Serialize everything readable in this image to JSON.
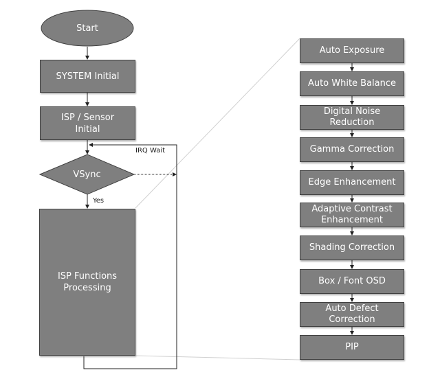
{
  "main_flow": {
    "start": "Start",
    "system_initial": "SYSTEM Initial",
    "sensor_initial": "ISP / Sensor Initial",
    "vsync": "VSync",
    "yes_label": "Yes",
    "irq_label": "IRQ Wait",
    "processing": "ISP Functions Processing"
  },
  "isp_functions": [
    "Auto Exposure",
    "Auto White Balance",
    "Digital Noise Reduction",
    "Gamma Correction",
    "Edge Enhancement",
    "Adaptive Contrast Enhancement",
    "Shading Correction",
    "Box / Font OSD",
    "Auto Defect Correction",
    "PIP"
  ],
  "colors": {
    "box_fill": "#7f7f7f",
    "text": "#ffffff",
    "line": "#333333"
  }
}
